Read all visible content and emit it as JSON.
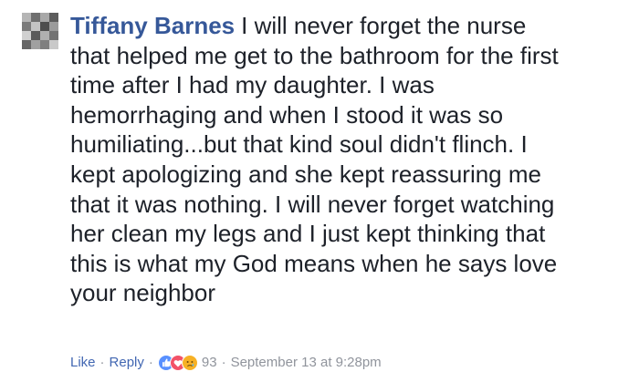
{
  "comment": {
    "author": "Tiffany Barnes",
    "lines": [
      "I will never forget the nurse",
      "that helped me get to the bathroom for the first",
      "time after I had my daughter. I was",
      "hemorrhaging and when I stood it was so",
      "humiliating...but that kind soul didn't flinch. I",
      "kept apologizing and she kept reassuring me",
      "that it was nothing. I will never forget watching",
      "her clean my legs and I just kept thinking that",
      "this is what my God means when he says love",
      "your neighbor"
    ],
    "actions": {
      "like_label": "Like",
      "separator": "·",
      "reply_label": "Reply",
      "reactions": [
        "like-icon",
        "love-icon",
        "sad-icon"
      ],
      "reaction_count": "93",
      "timestamp": "September 13 at 9:28pm"
    }
  },
  "colors": {
    "author": "#365899",
    "text": "#1d2129",
    "link": "#4267b2",
    "meta": "#90949c",
    "like_reaction": "#5890ff",
    "love_reaction": "#f25268",
    "sad_reaction": "#f7b125"
  }
}
